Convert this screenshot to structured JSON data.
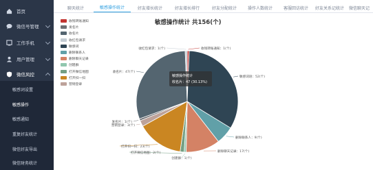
{
  "sidebar": {
    "items": [
      {
        "label": "首页",
        "icon": "home-icon"
      },
      {
        "label": "微信号管理",
        "icon": "chat-icon"
      },
      {
        "label": "工作手机",
        "icon": "phone-icon"
      },
      {
        "label": "用户管理",
        "icon": "user-icon"
      },
      {
        "label": "微信风控",
        "icon": "shield-icon"
      }
    ],
    "submenu": [
      "敏感词设置",
      "敏感操作",
      "敏感通知",
      "重复好友统计",
      "微信好友导出",
      "微信财务统计"
    ]
  },
  "tabs": [
    "聊天统计",
    "敏感操作统计",
    "好友增长统计",
    "好友增长排行",
    "好友分配统计",
    "操作人数统计",
    "客服回访统计",
    "好友关系记统计",
    "微信聊天记"
  ],
  "colors": {
    "sidebar": "#2b3648",
    "submenu": "#1f2838",
    "accent": "#2f9fe0"
  },
  "chart_data": {
    "type": "pie",
    "title": "敏感操作统计 共156(个)",
    "total": 156,
    "series": [
      {
        "name": "收钱转账通知",
        "value": 1,
        "color": "#c23531"
      },
      {
        "name": "敏感词",
        "value": 52,
        "color": "#2f4554"
      },
      {
        "name": "删除联系人",
        "value": 9,
        "color": "#61a0a8"
      },
      {
        "name": "删除聊天记录",
        "value": 17,
        "color": "#d48265"
      },
      {
        "name": "创建群",
        "value": 1,
        "color": "#91c7ae"
      },
      {
        "name": "打开微信地图",
        "value": 2,
        "color": "#749f83"
      },
      {
        "name": "打开扫一扫",
        "value": 23,
        "color": "#ca8622"
      },
      {
        "name": "营销登录",
        "value": 3,
        "color": "#bda29a"
      },
      {
        "name": "发名片",
        "value": 1,
        "color": "#6e7074"
      },
      {
        "name": "收名片",
        "value": 47,
        "color": "#546570"
      },
      {
        "name": "收红包请求",
        "value": 1,
        "color": "#c4ccd3"
      }
    ],
    "legend": [
      "收钱转账通知",
      "发名片",
      "收名片",
      "收红包请求",
      "敏感词",
      "删除联系人",
      "删除聊天记录",
      "创建群",
      "打开微信地图",
      "打开扫一扫",
      "营销登录"
    ],
    "labels": [
      "收钱转账通知：1(个)",
      "敏感词语：52(个)",
      "删除联系人：9(个)",
      "删除聊天记录：17(个)",
      "创建群：1(个)",
      "打开微信地图：2(个)",
      "打开扫一扫：23(个)",
      "营销登录：3(个)",
      "发名片：1(个)",
      "收名片：47(个)",
      "收红包请求：1(个)"
    ],
    "tooltip": {
      "title": "敏感操作统计",
      "text": "收名片：47 (30.13%)"
    }
  }
}
